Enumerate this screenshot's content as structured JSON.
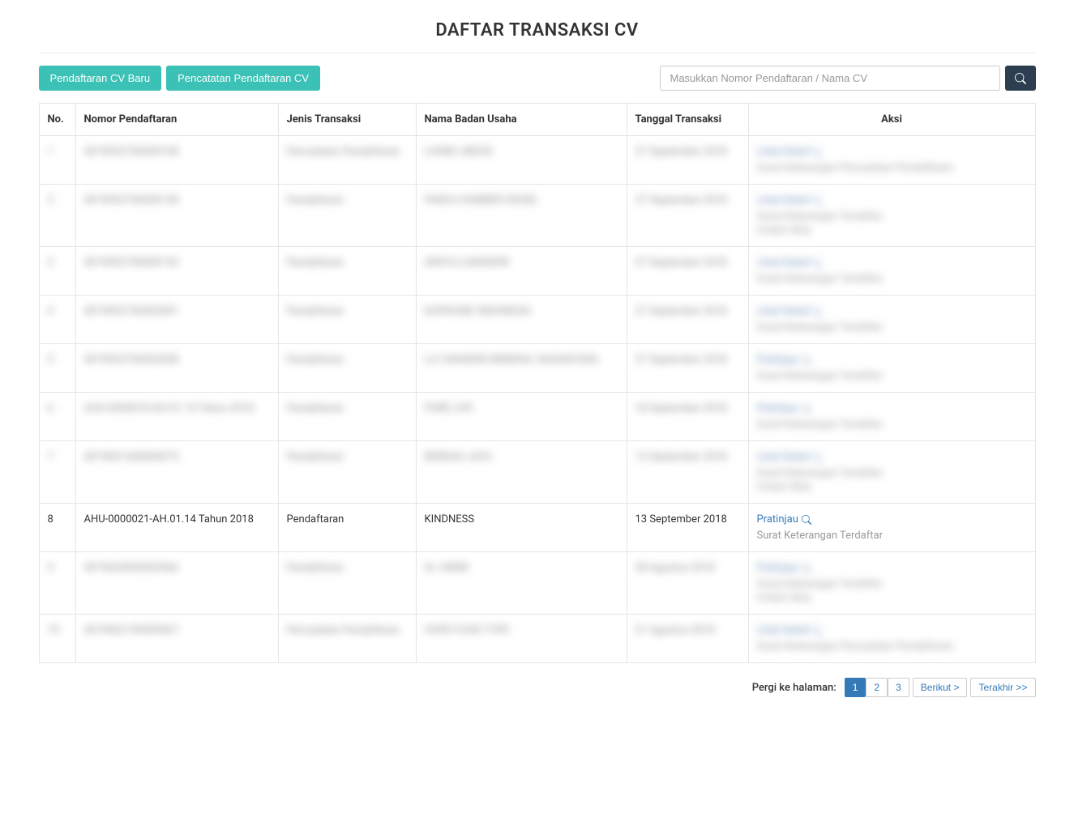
{
  "page_title": "DAFTAR TRANSAKSI CV",
  "toolbar": {
    "btn_new": "Pendaftaran CV Baru",
    "btn_record": "Pencatatan Pendaftaran CV"
  },
  "search": {
    "placeholder": "Masukkan Nomor Pendaftaran / Nama CV",
    "value": ""
  },
  "table": {
    "headers": {
      "no": "No.",
      "nomor": "Nomor Pendaftaran",
      "jenis": "Jenis Transaksi",
      "nama": "Nama Badan Usaha",
      "tanggal": "Tanggal Transaksi",
      "aksi": "Aksi"
    },
    "rows": [
      {
        "no": "1",
        "nomor": "4019052796000108",
        "jenis": "Pencatatan Pendaftaran",
        "nama": "LIONEL MESSI",
        "tanggal": "27 September 2018",
        "actions": [
          "Lihat Detail",
          "Surat Keterangan Pencatatan Pendaftaran"
        ],
        "blurred": true
      },
      {
        "no": "2",
        "nomor": "4019052796000138",
        "jenis": "Pendaftaran",
        "nama": "PANCA SUMBER DIESEL",
        "tanggal": "27 September 2018",
        "actions": [
          "Lihat Detail",
          "Surat Keterangan Terdaftar",
          "Unduh Akta"
        ],
        "blurred": true
      },
      {
        "no": "3",
        "nomor": "4019052796000153",
        "jenis": "Pendaftaran",
        "nama": "ARGYLA MANDIRI",
        "tanggal": "27 September 2018",
        "actions": [
          "Lihat Detail",
          "Surat Keterangan Terdaftar"
        ],
        "blurred": true
      },
      {
        "no": "4",
        "nomor": "4019052796502001",
        "jenis": "Pendaftaran",
        "nama": "KUPIKUNE INDONESIA",
        "tanggal": "27 September 2018",
        "actions": [
          "Lihat Detail",
          "Surat Keterangan Terdaftar"
        ],
        "blurred": true
      },
      {
        "no": "5",
        "nomor": "4019052796502058",
        "jenis": "Pendaftaran",
        "nama": "LLC MANDIRI MINERAL NUSANTARA",
        "tanggal": "27 September 2018",
        "actions": [
          "Pratinjau",
          "Surat Keterangan Terdaftar"
        ],
        "blurred": true
      },
      {
        "no": "6",
        "nomor": "AHU-0000018-AH.01.14 Tahun 2018",
        "jenis": "Pendaftaran",
        "nama": "PURE LIFE",
        "tanggal": "18 September 2018",
        "actions": [
          "Pratinjau",
          "Surat Keterangan Terdaftar"
        ],
        "blurred": true
      },
      {
        "no": "7",
        "nomor": "4019041360004075",
        "jenis": "Pendaftaran",
        "nama": "BERKAH JAYA",
        "tanggal": "13 September 2018",
        "actions": [
          "Lihat Detail",
          "Surat Keterangan Terdaftar",
          "Unduh Akta"
        ],
        "blurred": true
      },
      {
        "no": "8",
        "nomor": "AHU-0000021-AH.01.14 Tahun 2018",
        "jenis": "Pendaftaran",
        "nama": "KINDNESS",
        "tanggal": "13 September 2018",
        "actions": [
          "Pratinjau",
          "Surat Keterangan Terdaftar"
        ],
        "blurred": false
      },
      {
        "no": "9",
        "nomor": "4019024050502966",
        "jenis": "Pendaftaran",
        "nama": "AL HIKMI",
        "tanggal": "28 Agustus 2018",
        "actions": [
          "Pratinjau",
          "Surat Keterangan Terdaftar",
          "Unduh Akta"
        ],
        "blurred": true
      },
      {
        "no": "10",
        "nomor": "4019062190505967",
        "jenis": "Pencatatan Pendaftaran",
        "nama": "HOPE FOOD TYPE",
        "tanggal": "21 Agustus 2018",
        "actions": [
          "Lihat Detail",
          "Surat Keterangan Pencatatan Pendaftaran"
        ],
        "blurred": true
      }
    ]
  },
  "pagination": {
    "label": "Pergi ke halaman:",
    "pages": [
      "1",
      "2",
      "3"
    ],
    "active": "1",
    "next": "Berikut >",
    "last": "Terakhir >>"
  }
}
